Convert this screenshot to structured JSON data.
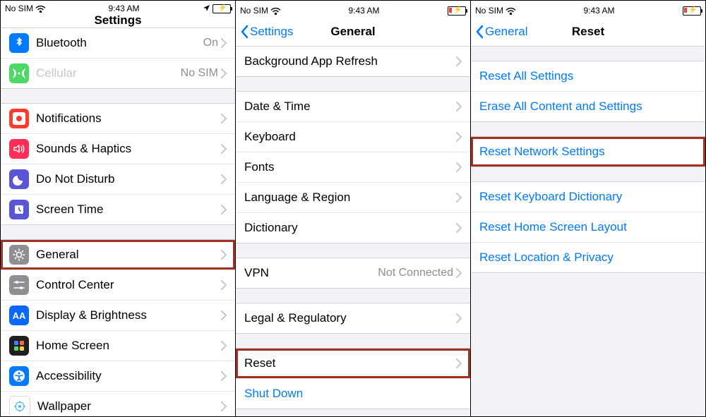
{
  "status": {
    "carrier": "No SIM",
    "time": "9:43 AM"
  },
  "p1": {
    "title": "Settings",
    "g1": [
      {
        "icon": "bluetooth",
        "label": "Bluetooth",
        "detail": "On",
        "color": "ic-blue"
      },
      {
        "icon": "cellular",
        "label": "Cellular",
        "detail": "No SIM",
        "color": "ic-green",
        "disabled": true
      }
    ],
    "g2": [
      {
        "icon": "notifications",
        "label": "Notifications",
        "color": "ic-red"
      },
      {
        "icon": "sounds",
        "label": "Sounds & Haptics",
        "color": "ic-pink"
      },
      {
        "icon": "dnd",
        "label": "Do Not Disturb",
        "color": "ic-purple"
      },
      {
        "icon": "screentime",
        "label": "Screen Time",
        "color": "ic-purple"
      }
    ],
    "g3": [
      {
        "icon": "general",
        "label": "General",
        "color": "ic-gray",
        "hl": true
      },
      {
        "icon": "controlcenter",
        "label": "Control Center",
        "color": "ic-gray"
      },
      {
        "icon": "display",
        "label": "Display & Brightness",
        "color": "ic-bb"
      },
      {
        "icon": "homescreen",
        "label": "Home Screen",
        "color": "ic-dk"
      },
      {
        "icon": "accessibility",
        "label": "Accessibility",
        "color": "ic-blue"
      },
      {
        "icon": "wallpaper",
        "label": "Wallpaper",
        "color": "ic-white"
      }
    ]
  },
  "p2": {
    "back": "Settings",
    "title": "General",
    "g0": [
      {
        "label": "Background App Refresh"
      }
    ],
    "g1": [
      {
        "label": "Date & Time"
      },
      {
        "label": "Keyboard"
      },
      {
        "label": "Fonts"
      },
      {
        "label": "Language & Region"
      },
      {
        "label": "Dictionary"
      }
    ],
    "g2": [
      {
        "label": "VPN",
        "detail": "Not Connected"
      }
    ],
    "g3": [
      {
        "label": "Legal & Regulatory"
      }
    ],
    "g4": [
      {
        "label": "Reset",
        "hl": true
      },
      {
        "label": "Shut Down",
        "blue": true,
        "nochev": true
      }
    ]
  },
  "p3": {
    "back": "General",
    "title": "Reset",
    "g1": [
      {
        "label": "Reset All Settings"
      },
      {
        "label": "Erase All Content and Settings"
      }
    ],
    "g2": [
      {
        "label": "Reset Network Settings",
        "hl": true
      }
    ],
    "g3": [
      {
        "label": "Reset Keyboard Dictionary"
      },
      {
        "label": "Reset Home Screen Layout"
      },
      {
        "label": "Reset Location & Privacy"
      }
    ]
  }
}
